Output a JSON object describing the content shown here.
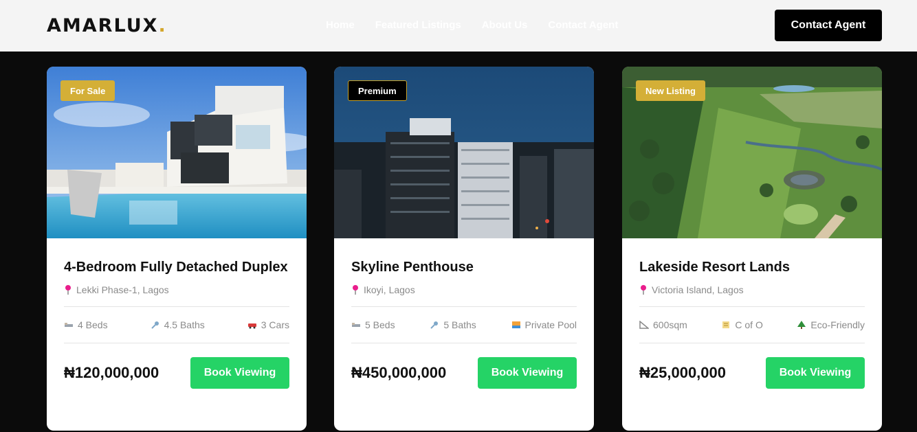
{
  "header": {
    "logo_text": "AMARLUX",
    "logo_dot": ".",
    "nav": [
      "Home",
      "Featured Listings",
      "About Us",
      "Contact Agent"
    ],
    "cta_label": "Contact Agent"
  },
  "listings": [
    {
      "badge": "For Sale",
      "title": "4-Bedroom Fully Detached Duplex",
      "location": "Lekki Phase-1, Lagos",
      "features": [
        {
          "icon": "bed-icon",
          "label": "4 Beds"
        },
        {
          "icon": "shower-icon",
          "label": "4.5 Baths"
        },
        {
          "icon": "car-icon",
          "label": "3 Cars"
        }
      ],
      "price": "₦120,000,000",
      "button": "Book Viewing"
    },
    {
      "badge": "Premium",
      "title": "Skyline Penthouse",
      "location": "Ikoyi, Lagos",
      "features": [
        {
          "icon": "bed-icon",
          "label": "5 Beds"
        },
        {
          "icon": "shower-icon",
          "label": "5 Baths"
        },
        {
          "icon": "pool-icon",
          "label": "Private Pool"
        }
      ],
      "price": "₦450,000,000",
      "button": "Book Viewing"
    },
    {
      "badge": "New Listing",
      "title": "Lakeside Resort Lands",
      "location": "Victoria Island, Lagos",
      "features": [
        {
          "icon": "ruler-icon",
          "label": "600sqm"
        },
        {
          "icon": "scroll-icon",
          "label": "C of O"
        },
        {
          "icon": "tree-icon",
          "label": "Eco-Friendly"
        }
      ],
      "price": "₦25,000,000",
      "button": "Book Viewing"
    }
  ],
  "colors": {
    "accent_gold": "#d4af37",
    "button_green": "#25d366",
    "pin_pink": "#e91e8c"
  }
}
